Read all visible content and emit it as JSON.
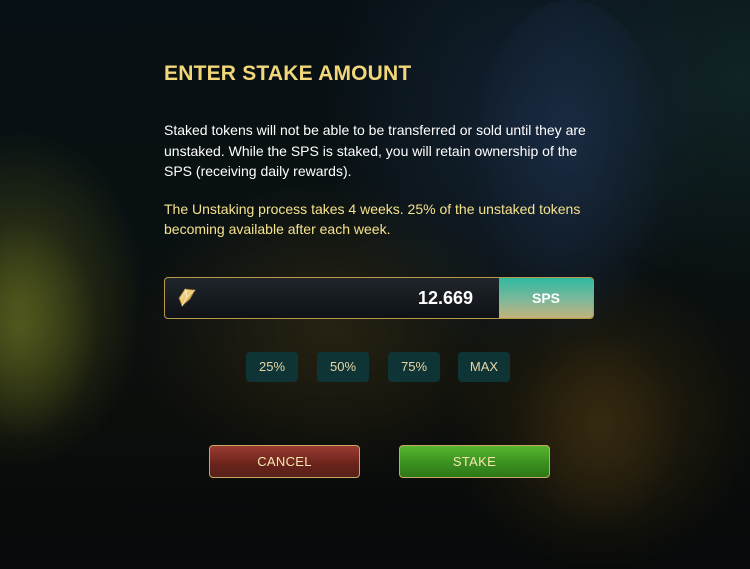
{
  "dialog": {
    "title": "ENTER STAKE AMOUNT",
    "description": "Staked tokens will not be able to be transferred or sold until they are unstaked. While the SPS is staked, you will retain ownership of the SPS (receiving daily rewards).",
    "note": "The Unstaking process takes 4 weeks. 25% of the unstaked tokens becoming available after each week."
  },
  "amount_field": {
    "value": "12.669",
    "unit": "SPS",
    "icon": "sps-token-icon"
  },
  "percent_buttons": [
    {
      "label": "25%"
    },
    {
      "label": "50%"
    },
    {
      "label": "75%"
    },
    {
      "label": "MAX"
    }
  ],
  "actions": {
    "cancel_label": "CANCEL",
    "stake_label": "STAKE"
  },
  "colors": {
    "title": "#f2d77a",
    "note": "#f5e28c",
    "cancel": "#7a2b22",
    "stake": "#45a024",
    "unit_badge": "#2fb9a0",
    "percent_button": "#0f3436"
  }
}
